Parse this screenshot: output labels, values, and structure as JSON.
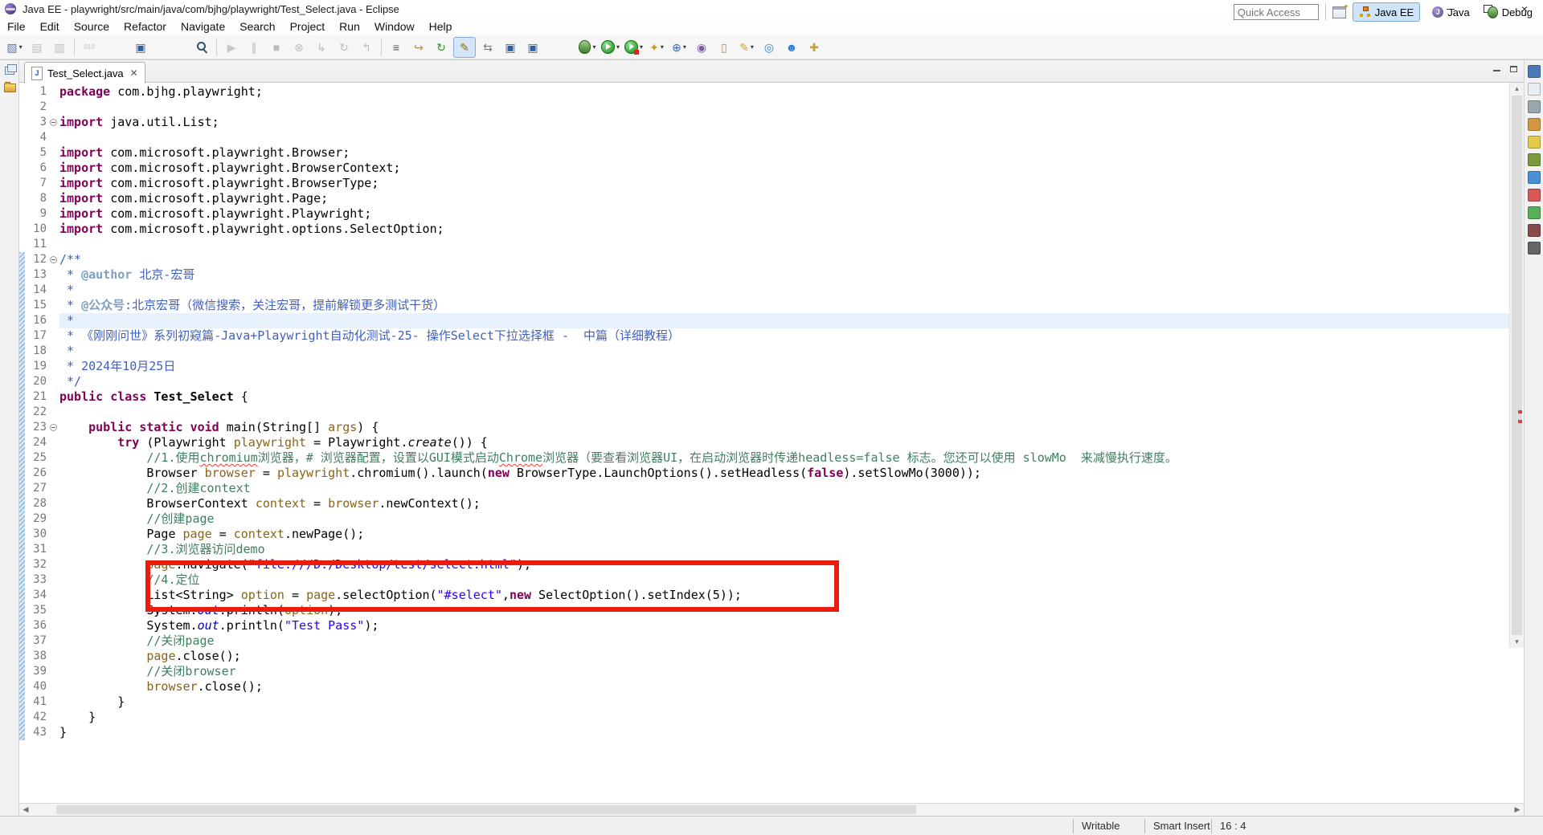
{
  "window": {
    "title": "Java EE - playwright/src/main/java/com/bjhg/playwright/Test_Select.java - Eclipse"
  },
  "menu": {
    "items": [
      "File",
      "Edit",
      "Source",
      "Refactor",
      "Navigate",
      "Search",
      "Project",
      "Run",
      "Window",
      "Help"
    ]
  },
  "toolbar": {
    "quick_access_placeholder": "Quick Access",
    "items": [
      {
        "name": "new-wizard-button",
        "glyph": "▧",
        "color": "#5b77a5",
        "caret": true
      },
      {
        "name": "save-button",
        "glyph": "▤",
        "color": "#556",
        "disabled": true
      },
      {
        "name": "save-all-button",
        "glyph": "▥",
        "color": "#556",
        "disabled": true
      },
      {
        "sep": true
      },
      {
        "name": "class-file-button",
        "glyph": "010",
        "color": "#6a8cbf",
        "small": true,
        "disabled": true
      },
      {
        "gap": 36
      },
      {
        "name": "console-button",
        "glyph": "▣",
        "color": "#2f5fa3"
      },
      {
        "gap": 48
      },
      {
        "name": "search-button",
        "cls": "i-search"
      },
      {
        "sep": true
      },
      {
        "name": "resume-button",
        "glyph": "▶",
        "color": "#2e8b2e",
        "disabled": true
      },
      {
        "name": "pause-button",
        "glyph": "∥",
        "color": "#444",
        "disabled": true
      },
      {
        "name": "stop-button",
        "glyph": "■",
        "color": "#a33",
        "disabled": true
      },
      {
        "name": "disconnect-button",
        "glyph": "⊗",
        "color": "#555",
        "disabled": true
      },
      {
        "name": "step-into-button",
        "glyph": "↳",
        "color": "#555",
        "disabled": true
      },
      {
        "name": "step-over-button",
        "glyph": "↻",
        "color": "#555",
        "disabled": true
      },
      {
        "name": "step-return-button",
        "glyph": "↰",
        "color": "#555",
        "disabled": true
      },
      {
        "sep": true
      },
      {
        "name": "last-edit-location-button",
        "glyph": "≡",
        "color": "#555"
      },
      {
        "name": "back-history-button",
        "glyph": "↪",
        "color": "#d2861f"
      },
      {
        "name": "relaunch-button",
        "glyph": "↻",
        "color": "#2f8f2f"
      },
      {
        "name": "mark-occurrences-toggle",
        "glyph": "✎",
        "color": "#8a6d1a",
        "active": true
      },
      {
        "name": "link-editor-button",
        "glyph": "⇆",
        "color": "#777"
      },
      {
        "name": "show-console-view-button",
        "glyph": "▣",
        "color": "#2f5fa3"
      },
      {
        "name": "show-properties-view-button",
        "glyph": "▣",
        "color": "#2f5fa3"
      },
      {
        "gap": 40
      },
      {
        "name": "debug-button",
        "cls": "i-bug",
        "caret": true
      },
      {
        "name": "run-button",
        "cls": "i-run",
        "caret": true
      },
      {
        "name": "coverage-button",
        "cls": "i-cov",
        "caret": true
      },
      {
        "name": "new-java-ee-project-button",
        "glyph": "✦",
        "color": "#c89b2a",
        "caret": true
      },
      {
        "name": "new-web-service-button",
        "glyph": "⊕",
        "color": "#2a62c8",
        "caret": true
      },
      {
        "name": "deploy-module-button",
        "glyph": "◉",
        "color": "#7b5ea7"
      },
      {
        "name": "clipboard-button",
        "glyph": "▯",
        "color": "#b08d57"
      },
      {
        "name": "annotate-button",
        "glyph": "✎",
        "color": "#caa53d",
        "caret": true
      },
      {
        "name": "open-browser-button",
        "glyph": "◎",
        "color": "#2e7dd1"
      },
      {
        "name": "external-browser-button",
        "glyph": "☻",
        "color": "#2e7dd1"
      },
      {
        "name": "key-button",
        "glyph": "✚",
        "color": "#c8a23d"
      }
    ]
  },
  "perspectives": {
    "items": [
      {
        "label": "Java EE",
        "active": true
      },
      {
        "label": "Java",
        "active": false
      },
      {
        "label": "Debug",
        "active": false
      }
    ]
  },
  "left_strip": {
    "icons": [
      "restore-view-icon",
      "project-explorer-icon"
    ]
  },
  "right_strip": {
    "icons": [
      {
        "name": "minimized-view-icon-1",
        "color": "#4a7ab5"
      },
      {
        "name": "minimized-view-icon-2",
        "color": "#e8eef5"
      },
      {
        "name": "minimized-view-icon-3",
        "color": "#9aa7b0"
      },
      {
        "name": "minimized-view-icon-4",
        "color": "#d29642"
      },
      {
        "name": "minimized-view-icon-5",
        "color": "#e3c94c"
      },
      {
        "name": "minimized-view-icon-6",
        "color": "#7a9a3d"
      },
      {
        "name": "minimized-view-icon-7",
        "color": "#4a90d9"
      },
      {
        "name": "minimized-view-icon-8",
        "color": "#d95757"
      },
      {
        "name": "minimized-view-icon-9",
        "color": "#57b057"
      },
      {
        "name": "minimized-view-icon-10",
        "color": "#8a4a4a"
      },
      {
        "name": "minimized-view-icon-11",
        "color": "#666666"
      }
    ]
  },
  "editor": {
    "tab": {
      "label": "Test_Select.java"
    },
    "current_line": 16,
    "annotation": {
      "type": "red-box",
      "covers_lines": "32-35"
    },
    "lines": [
      {
        "n": 1,
        "seg": [
          [
            "k",
            "package"
          ],
          [
            "p",
            " com.bjhg.playwright;"
          ]
        ]
      },
      {
        "n": 2,
        "seg": []
      },
      {
        "n": 3,
        "fold": true,
        "seg": [
          [
            "k",
            "import"
          ],
          [
            "p",
            " java.util.List;"
          ]
        ]
      },
      {
        "n": 4,
        "seg": []
      },
      {
        "n": 5,
        "seg": [
          [
            "k",
            "import"
          ],
          [
            "p",
            " com.microsoft.playwright.Browser;"
          ]
        ]
      },
      {
        "n": 6,
        "seg": [
          [
            "k",
            "import"
          ],
          [
            "p",
            " com.microsoft.playwright.BrowserContext;"
          ]
        ]
      },
      {
        "n": 7,
        "seg": [
          [
            "k",
            "import"
          ],
          [
            "p",
            " com.microsoft.playwright.BrowserType;"
          ]
        ]
      },
      {
        "n": 8,
        "seg": [
          [
            "k",
            "import"
          ],
          [
            "p",
            " com.microsoft.playwright.Page;"
          ]
        ]
      },
      {
        "n": 9,
        "seg": [
          [
            "k",
            "import"
          ],
          [
            "p",
            " com.microsoft.playwright.Playwright;"
          ]
        ]
      },
      {
        "n": 10,
        "seg": [
          [
            "k",
            "import"
          ],
          [
            "p",
            " com.microsoft.playwright.options.SelectOption;"
          ]
        ]
      },
      {
        "n": 11,
        "seg": []
      },
      {
        "n": 12,
        "fold": true,
        "seg": [
          [
            "j",
            "/**"
          ]
        ]
      },
      {
        "n": 13,
        "seg": [
          [
            "j",
            " * "
          ],
          [
            "jt",
            "@author"
          ],
          [
            "j",
            " 北京-宏哥"
          ]
        ]
      },
      {
        "n": 14,
        "seg": [
          [
            "j",
            " *"
          ]
        ]
      },
      {
        "n": 15,
        "seg": [
          [
            "j",
            " * "
          ],
          [
            "jt",
            "@公众号"
          ],
          [
            "j",
            ":北京宏哥（微信搜索，关注宏哥，提前解锁更多测试干货）"
          ]
        ]
      },
      {
        "n": 16,
        "hl": true,
        "seg": [
          [
            "j",
            " *"
          ]
        ]
      },
      {
        "n": 17,
        "seg": [
          [
            "j",
            " * 《刚刚问世》系列初窥篇-Java+Playwright自动化测试-25- 操作Select下拉选择框 -  中篇（详细教程）"
          ]
        ]
      },
      {
        "n": 18,
        "seg": [
          [
            "j",
            " *"
          ]
        ]
      },
      {
        "n": 19,
        "seg": [
          [
            "j",
            " * 2024年10月25日"
          ]
        ]
      },
      {
        "n": 20,
        "seg": [
          [
            "j",
            " */"
          ]
        ]
      },
      {
        "n": 21,
        "seg": [
          [
            "k",
            "public"
          ],
          [
            "p",
            " "
          ],
          [
            "k",
            "class"
          ],
          [
            "p",
            " "
          ],
          [
            "b",
            "Test_Select"
          ],
          [
            "p",
            " {"
          ]
        ]
      },
      {
        "n": 22,
        "seg": []
      },
      {
        "n": 23,
        "fold": true,
        "seg": [
          [
            "p",
            "    "
          ],
          [
            "k",
            "public"
          ],
          [
            "p",
            " "
          ],
          [
            "k",
            "static"
          ],
          [
            "p",
            " "
          ],
          [
            "k",
            "void"
          ],
          [
            "p",
            " main(String[] "
          ],
          [
            "v",
            "args"
          ],
          [
            "p",
            ") {"
          ]
        ]
      },
      {
        "n": 24,
        "seg": [
          [
            "p",
            "        "
          ],
          [
            "k",
            "try"
          ],
          [
            "p",
            " (Playwright "
          ],
          [
            "v",
            "playwright"
          ],
          [
            "p",
            " = Playwright."
          ],
          [
            "sm",
            "create"
          ],
          [
            "p",
            "()) {"
          ]
        ]
      },
      {
        "n": 25,
        "seg": [
          [
            "p",
            "            "
          ],
          [
            "c",
            "//1.使用"
          ],
          [
            "w",
            "chromium"
          ],
          [
            "c",
            "浏览器，# 浏览器配置，设置以GUI模式启动"
          ],
          [
            "w",
            "Chrome"
          ],
          [
            "c",
            "浏览器（要查看浏览器UI，在启动浏览器时传递headless=false 标志。您还可以使用 slowMo  来减慢执行速度。"
          ]
        ]
      },
      {
        "n": 26,
        "seg": [
          [
            "p",
            "            Browser "
          ],
          [
            "v",
            "browser"
          ],
          [
            "p",
            " = "
          ],
          [
            "v",
            "playwright"
          ],
          [
            "p",
            ".chromium().launch("
          ],
          [
            "k",
            "new"
          ],
          [
            "p",
            " BrowserType.LaunchOptions().setHeadless("
          ],
          [
            "k",
            "false"
          ],
          [
            "p",
            ").setSlowMo(3000));"
          ]
        ]
      },
      {
        "n": 27,
        "seg": [
          [
            "p",
            "            "
          ],
          [
            "c",
            "//2.创建context"
          ]
        ]
      },
      {
        "n": 28,
        "seg": [
          [
            "p",
            "            BrowserContext "
          ],
          [
            "v",
            "context"
          ],
          [
            "p",
            " = "
          ],
          [
            "v",
            "browser"
          ],
          [
            "p",
            ".newContext();"
          ]
        ]
      },
      {
        "n": 29,
        "seg": [
          [
            "p",
            "            "
          ],
          [
            "c",
            "//创建page"
          ]
        ]
      },
      {
        "n": 30,
        "seg": [
          [
            "p",
            "            Page "
          ],
          [
            "v",
            "page"
          ],
          [
            "p",
            " = "
          ],
          [
            "v",
            "context"
          ],
          [
            "p",
            ".newPage();"
          ]
        ]
      },
      {
        "n": 31,
        "seg": [
          [
            "p",
            "            "
          ],
          [
            "c",
            "//3.浏览器访问demo"
          ]
        ]
      },
      {
        "n": 32,
        "seg": [
          [
            "p",
            "            "
          ],
          [
            "v",
            "page"
          ],
          [
            "p",
            ".navigate("
          ],
          [
            "s",
            "\"file:///D:/Desktop/test/select.html\""
          ],
          [
            "p",
            ");"
          ]
        ]
      },
      {
        "n": 33,
        "seg": [
          [
            "p",
            "            "
          ],
          [
            "c",
            "//4.定位"
          ]
        ]
      },
      {
        "n": 34,
        "seg": [
          [
            "p",
            "            List<String> "
          ],
          [
            "v",
            "option"
          ],
          [
            "p",
            " = "
          ],
          [
            "v",
            "page"
          ],
          [
            "p",
            ".selectOption("
          ],
          [
            "s",
            "\"#select\""
          ],
          [
            "p",
            ","
          ],
          [
            "k",
            "new"
          ],
          [
            "p",
            " SelectOption().setIndex(5));"
          ]
        ]
      },
      {
        "n": 35,
        "seg": [
          [
            "p",
            "            System."
          ],
          [
            "sf",
            "out"
          ],
          [
            "p",
            ".println("
          ],
          [
            "v",
            "option"
          ],
          [
            "p",
            ");"
          ]
        ]
      },
      {
        "n": 36,
        "seg": [
          [
            "p",
            "            System."
          ],
          [
            "sf",
            "out"
          ],
          [
            "p",
            ".println("
          ],
          [
            "s",
            "\"Test Pass\""
          ],
          [
            "p",
            ");"
          ]
        ]
      },
      {
        "n": 37,
        "seg": [
          [
            "p",
            "            "
          ],
          [
            "c",
            "//关闭page"
          ]
        ]
      },
      {
        "n": 38,
        "seg": [
          [
            "p",
            "            "
          ],
          [
            "v",
            "page"
          ],
          [
            "p",
            ".close();"
          ]
        ]
      },
      {
        "n": 39,
        "seg": [
          [
            "p",
            "            "
          ],
          [
            "c",
            "//关闭browser"
          ]
        ]
      },
      {
        "n": 40,
        "seg": [
          [
            "p",
            "            "
          ],
          [
            "v",
            "browser"
          ],
          [
            "p",
            ".close();"
          ]
        ]
      },
      {
        "n": 41,
        "seg": [
          [
            "p",
            "        }"
          ]
        ]
      },
      {
        "n": 42,
        "seg": [
          [
            "p",
            "    }"
          ]
        ]
      },
      {
        "n": 43,
        "seg": [
          [
            "p",
            "}"
          ]
        ]
      }
    ]
  },
  "status_bar": {
    "writable": "Writable",
    "insert_mode": "Smart Insert",
    "cursor_position": "16 : 4"
  }
}
